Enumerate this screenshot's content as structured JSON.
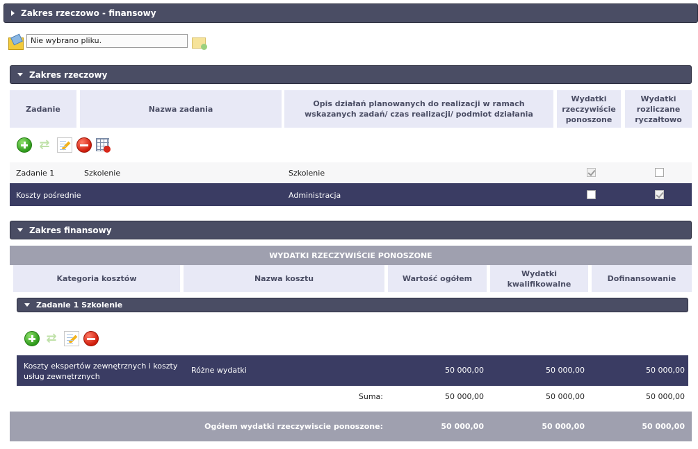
{
  "sections": {
    "main": "Zakres rzeczowo - finansowy",
    "rzeczowy": "Zakres rzeczowy",
    "finansowy": "Zakres finansowy"
  },
  "file": {
    "value": "Nie wybrano pliku."
  },
  "icons": {
    "upload": "attach-file-icon",
    "remove_file": "remove-file-icon",
    "add": "add-icon",
    "sync": "sync-icon",
    "edit": "edit-icon",
    "delete": "delete-icon",
    "table": "table-icon"
  },
  "rzeczowy_table": {
    "headers": {
      "zadanie": "Zadanie",
      "nazwa": "Nazwa zadania",
      "opis": "Opis działań planowanych do realizacji w ramach wskazanych zadań/ czas realizacji/ podmiot działania",
      "rzeczywiste": "Wydatki rzeczywiście ponoszone",
      "ryczaltowe": "Wydatki rozliczane ryczałtowo"
    },
    "rows": [
      {
        "zadanie": "Zadanie 1",
        "nazwa": "Szkolenie",
        "opis": "Szkolenie",
        "rzeczywiste": true,
        "ryczaltowe": false
      },
      {
        "zadanie": "Koszty pośrednie",
        "nazwa": "",
        "opis": "Administracja",
        "rzeczywiste": false,
        "ryczaltowe": true
      }
    ]
  },
  "finansowy_table": {
    "group_header": "WYDATKI RZECZYWIŚCIE PONOSZONE",
    "headers": {
      "kategoria": "Kategoria kosztów",
      "nazwa": "Nazwa kosztu",
      "wartosc": "Wartość ogółem",
      "kwalifikowalne": "Wydatki kwalifikowalne",
      "dofinansowanie": "Dofinansowanie"
    },
    "task_header": "Zadanie 1 Szkolenie",
    "rows": [
      {
        "kategoria": "Koszty ekspertów zewnętrznych i koszty usług zewnętrznych",
        "nazwa": "Różne wydatki",
        "wartosc": "50 000,00",
        "kwalifikowalne": "50 000,00",
        "dofinansowanie": "50 000,00"
      }
    ],
    "suma": {
      "label": "Suma:",
      "wartosc": "50 000,00",
      "kwalifikowalne": "50 000,00",
      "dofinansowanie": "50 000,00"
    },
    "ogolem": {
      "label": "Ogółem wydatki rzeczywiscie ponoszone:",
      "wartosc": "50 000,00",
      "kwalifikowalne": "50 000,00",
      "dofinansowanie": "50 000,00"
    }
  },
  "colors": {
    "section_bar": "#4a4d64",
    "header_cell": "#e8e9f6",
    "dark_row": "#3a3c63",
    "summary_bar": "#9fa0af"
  }
}
